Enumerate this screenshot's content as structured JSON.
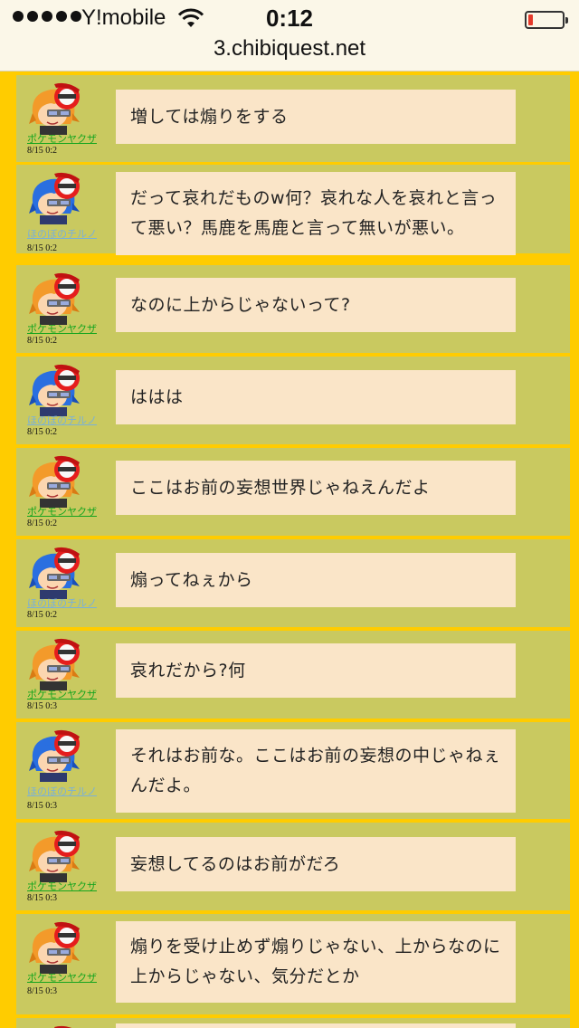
{
  "status": {
    "carrier": "Y!mobile",
    "time": "0:12",
    "url": "3.chibiquest.net"
  },
  "messages": [
    {
      "user": "ポケモンヤクザ",
      "time": "8/15 0:2",
      "text": "増しては煽りをする"
    },
    {
      "user": "ほのぼのチルノ",
      "time": "8/15 0:2",
      "text": "だって哀れだものw何？哀れな人を哀れと言って悪い？馬鹿を馬鹿と言って無いが悪い。"
    },
    {
      "user": "ポケモンヤクザ",
      "time": "8/15 0:2",
      "text": "なのに上からじゃないって?"
    },
    {
      "user": "ほのぼのチルノ",
      "time": "8/15 0:2",
      "text": "ははは"
    },
    {
      "user": "ポケモンヤクザ",
      "time": "8/15 0:2",
      "text": "ここはお前の妄想世界じゃねえんだよ"
    },
    {
      "user": "ほのぼのチルノ",
      "time": "8/15 0:2",
      "text": "煽ってねぇから"
    },
    {
      "user": "ポケモンヤクザ",
      "time": "8/15 0:3",
      "text": "哀れだから?何"
    },
    {
      "user": "ほのぼのチルノ",
      "time": "8/15 0:3",
      "text": "それはお前な。ここはお前の妄想の中じゃねぇんだよ。"
    },
    {
      "user": "ポケモンヤクザ",
      "time": "8/15 0:3",
      "text": "妄想してるのはお前がだろ"
    },
    {
      "user": "ポケモンヤクザ",
      "time": "8/15 0:3",
      "text": "煽りを受け止めず煽りじゃない、上からなのに上からじゃない、気分だとか"
    }
  ]
}
